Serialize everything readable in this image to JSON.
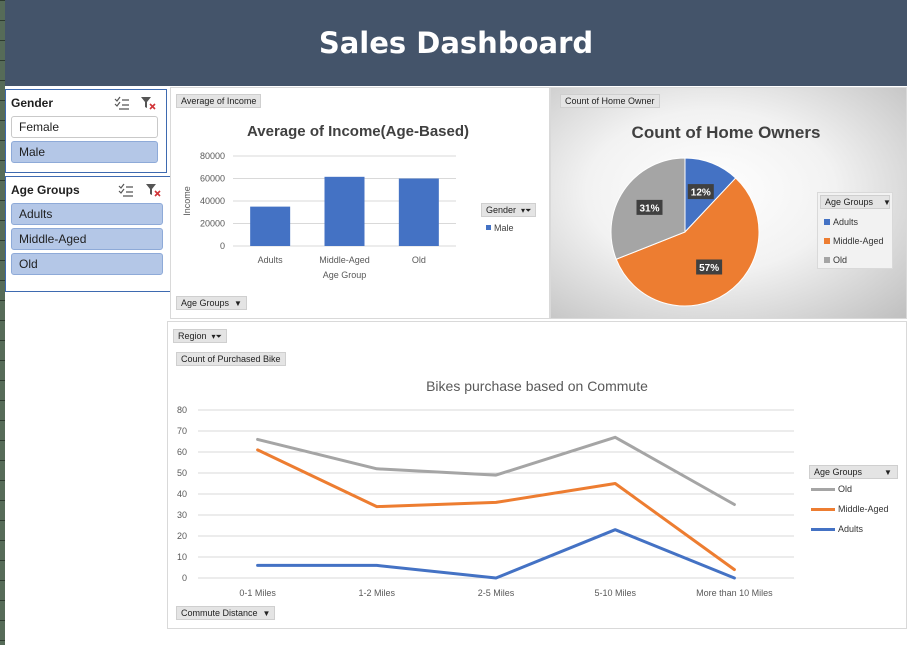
{
  "header": {
    "title": "Sales Dashboard"
  },
  "gender_slicer": {
    "title": "Gender",
    "items": [
      {
        "label": "Female",
        "selected": false
      },
      {
        "label": "Male",
        "selected": true
      }
    ]
  },
  "age_slicer": {
    "title": "Age Groups",
    "items": [
      {
        "label": "Adults",
        "selected": true
      },
      {
        "label": "Middle-Aged",
        "selected": true
      },
      {
        "label": "Old",
        "selected": true
      }
    ]
  },
  "income_panel": {
    "field_value": "Average of Income",
    "field_axis": "Age Groups",
    "legend_field": "Gender",
    "legend_item": "Male"
  },
  "home_panel": {
    "field_value": "Count of Home Owner",
    "legend_field": "Age Groups",
    "legend_items": [
      "Adults",
      "Middle-Aged",
      "Old"
    ]
  },
  "bike_panel": {
    "filter_field": "Region",
    "field_value": "Count of Purchased Bike",
    "field_axis": "Commute Distance",
    "legend_field": "Age Groups",
    "legend_items": [
      "Old",
      "Middle-Aged",
      "Adults"
    ]
  },
  "colors": {
    "header": "#44546a",
    "blue": "#4472c4",
    "orange": "#ed7d31",
    "gray": "#a5a5a5"
  },
  "chart_data": [
    {
      "type": "bar",
      "title": "Average of Income(Age-Based)",
      "xlabel": "Age Group",
      "ylabel": "Income",
      "categories": [
        "Adults",
        "Middle-Aged",
        "Old"
      ],
      "series": [
        {
          "name": "Male",
          "values": [
            35000,
            61500,
            60000
          ]
        }
      ],
      "ylim": [
        0,
        80000
      ],
      "yticks": [
        0,
        20000,
        40000,
        60000,
        80000
      ],
      "grid": true,
      "legend": "right"
    },
    {
      "type": "pie",
      "title": "Count of Home Owners",
      "categories": [
        "Adults",
        "Middle-Aged",
        "Old"
      ],
      "values": [
        12,
        57,
        31
      ],
      "labels": [
        "12%",
        "57%",
        "31%"
      ],
      "legend": "right"
    },
    {
      "type": "line",
      "title": "Bikes purchase based on Commute",
      "categories": [
        "0-1 Miles",
        "1-2 Miles",
        "2-5 Miles",
        "5-10 Miles",
        "More than 10 Miles"
      ],
      "series": [
        {
          "name": "Old",
          "values": [
            66,
            52,
            49,
            67,
            35
          ]
        },
        {
          "name": "Middle-Aged",
          "values": [
            61,
            34,
            36,
            45,
            4
          ]
        },
        {
          "name": "Adults",
          "values": [
            6,
            6,
            0,
            23,
            0
          ]
        }
      ],
      "ylim": [
        0,
        80
      ],
      "yticks": [
        0,
        10,
        20,
        30,
        40,
        50,
        60,
        70,
        80
      ],
      "grid": true,
      "legend": "right"
    }
  ]
}
